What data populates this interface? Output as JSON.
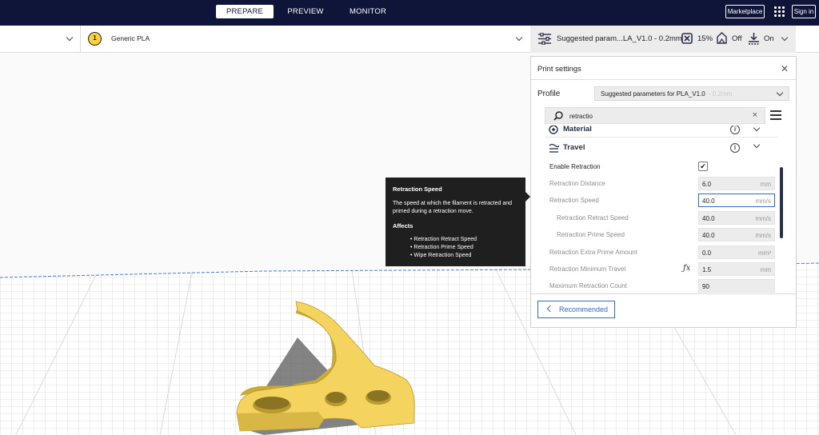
{
  "topbar": {
    "tabs": [
      {
        "label": "PREPARE",
        "active": true
      },
      {
        "label": "PREVIEW",
        "active": false
      },
      {
        "label": "MONITOR",
        "active": false
      }
    ],
    "marketplace_label": "Marketplace",
    "signin_label": "Sign in"
  },
  "header": {
    "extruder_number": "1",
    "material_name": "Generic PLA",
    "profile_summary": "Suggested param...LA_V1.0 - 0.2mm",
    "infill_value": "15%",
    "support_value": "Off",
    "adhesion_value": "On"
  },
  "print_settings": {
    "title": "Print settings",
    "profile_label": "Profile",
    "profile_value": "Suggested parameters for PLA_V1.0",
    "profile_suffix": "- 0.2mm",
    "search_value": "retractio",
    "categories": [
      {
        "name": "Material",
        "icon": "material-icon"
      },
      {
        "name": "Travel",
        "icon": "travel-icon"
      }
    ],
    "rows": [
      {
        "label": "Enable Retraction",
        "type": "checkbox",
        "checked": true,
        "check_glyph": "✔",
        "enabled": true
      },
      {
        "label": "Retraction Distance",
        "value": "6.0",
        "unit": "mm"
      },
      {
        "label": "Retraction Speed",
        "value": "40.0",
        "unit": "mm/s",
        "focused": true
      },
      {
        "label": "Retraction Retract Speed",
        "value": "40.0",
        "unit": "mm/s",
        "indent": true
      },
      {
        "label": "Retraction Prime Speed",
        "value": "40.0",
        "unit": "mm/s",
        "indent": true
      },
      {
        "label": "Retraction Extra Prime Amount",
        "value": "0.0",
        "unit": "mm³"
      },
      {
        "label": "Retraction Minimum Travel",
        "value": "1.5",
        "unit": "mm",
        "function": "ƒx"
      },
      {
        "label": "Maximum Retraction Count",
        "value": "90",
        "unit": ""
      }
    ],
    "recommended_label": "Recommended"
  },
  "tooltip": {
    "title": "Retraction Speed",
    "description": "The speed at which the filament is retracted and primed during a retraction move.",
    "affects_label": "Affects",
    "affects": [
      "• Retraction Retract Speed",
      "• Retraction Prime Speed",
      "• Wipe Retraction Speed"
    ]
  },
  "colors": {
    "topbar_bg": "#0e1539",
    "accent_blue": "#2a6fcf",
    "model_yellow": "#f4d35e",
    "extruder_yellow": "#fbd340"
  }
}
